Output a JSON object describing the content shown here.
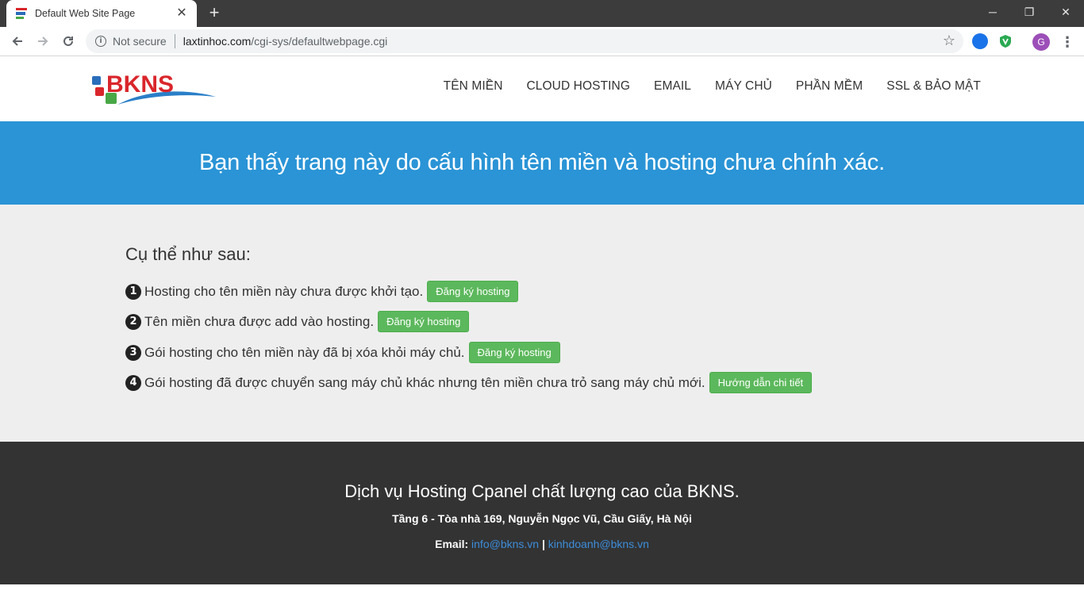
{
  "browser": {
    "tab_title": "Default Web Site Page",
    "tab_close": "✕",
    "new_tab": "+",
    "security_label": "Not secure",
    "url_domain": "laxtinhoc.com",
    "url_path": "/cgi-sys/defaultwebpage.cgi",
    "profile_initial": "G",
    "window_controls": {
      "minimize": "─",
      "restore": "❐",
      "close": "✕"
    }
  },
  "header": {
    "logo_text": "BKNS",
    "nav": [
      "TÊN MIỀN",
      "CLOUD HOSTING",
      "EMAIL",
      "MÁY CHỦ",
      "PHẦN MỀM",
      "SSL & BẢO MẬT"
    ]
  },
  "banner": {
    "headline": "Bạn thấy trang này do cấu hình tên miền và hosting chưa chính xác."
  },
  "content": {
    "heading": "Cụ thể như sau:",
    "reasons": [
      {
        "num": "1",
        "text": "Hosting cho tên miền này chưa được khởi tạo.",
        "button": "Đăng ký hosting"
      },
      {
        "num": "2",
        "text": "Tên miền chưa được add vào hosting.",
        "button": "Đăng ký hosting"
      },
      {
        "num": "3",
        "text": "Gói hosting cho tên miền này đã bị xóa khỏi máy chủ.",
        "button": "Đăng ký hosting"
      },
      {
        "num": "4",
        "text": "Gói hosting đã được chuyển sang máy chủ khác nhưng tên miền chưa trỏ sang máy chủ mới.",
        "button": "Hướng dẫn chi tiết"
      }
    ]
  },
  "footer": {
    "title": "Dịch vụ Hosting Cpanel chất lượng cao của BKNS.",
    "address": "Tầng 6 - Tòa nhà 169, Nguyễn Ngọc Vũ, Cầu Giấy, Hà Nội",
    "email_label": "Email:",
    "email_1": "info@bkns.vn",
    "separator": "|",
    "email_2": "kinhdoanh@bkns.vn"
  },
  "colors": {
    "banner": "#2a94d6",
    "content_bg": "#eeeeee",
    "footer_bg": "#333333",
    "button_green": "#5cb85c",
    "link_blue": "#3c8ddb"
  }
}
